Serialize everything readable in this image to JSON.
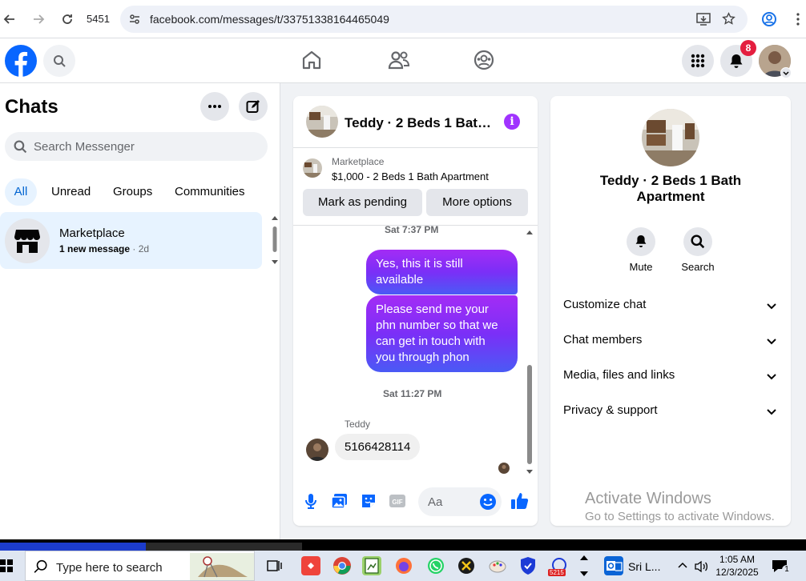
{
  "browser": {
    "tab_count": "5451",
    "url": "facebook.com/messages/t/33751338164465049"
  },
  "header": {
    "notification_count": "8"
  },
  "chats": {
    "title": "Chats",
    "search_placeholder": "Search Messenger",
    "filters": [
      "All",
      "Unread",
      "Groups",
      "Communities"
    ],
    "active_filter": "All",
    "items": [
      {
        "name": "Marketplace",
        "preview": "1 new message",
        "age": "· 2d"
      }
    ]
  },
  "conversation": {
    "title": "Teddy · 2 Beds 1 Bath Apartment",
    "marketplace_label": "Marketplace",
    "listing": "$1,000 - 2 Beds 1 Bath Apartment",
    "mark_pending": "Mark as pending",
    "more_options": "More options",
    "messages": [
      {
        "type": "timestamp",
        "text": "Sat 7:37 PM"
      },
      {
        "type": "outgoing",
        "text": "Yes, this it is still available"
      },
      {
        "type": "outgoing",
        "text": "Please send me your phn number so that we can get in touch with you through phon"
      },
      {
        "type": "timestamp",
        "text": "Sat 11:27 PM"
      },
      {
        "type": "sender",
        "text": "Teddy"
      },
      {
        "type": "incoming",
        "text": "5166428114"
      }
    ],
    "composer_placeholder": "Aa",
    "accent": "#0866ff"
  },
  "details": {
    "title": "Teddy · 2 Beds 1 Bath Apartment",
    "actions": [
      "Mute",
      "Search"
    ],
    "sections": [
      "Customize chat",
      "Chat members",
      "Media, files and links",
      "Privacy & support"
    ],
    "watermark_title": "Activate Windows",
    "watermark_sub": "Go to Settings to activate Windows."
  },
  "taskbar": {
    "search_placeholder": "Type here to search",
    "app_label": "Sri L...",
    "time": "1:05 AM",
    "date": "12/3/2025",
    "badge": "5215",
    "notif": "1"
  }
}
